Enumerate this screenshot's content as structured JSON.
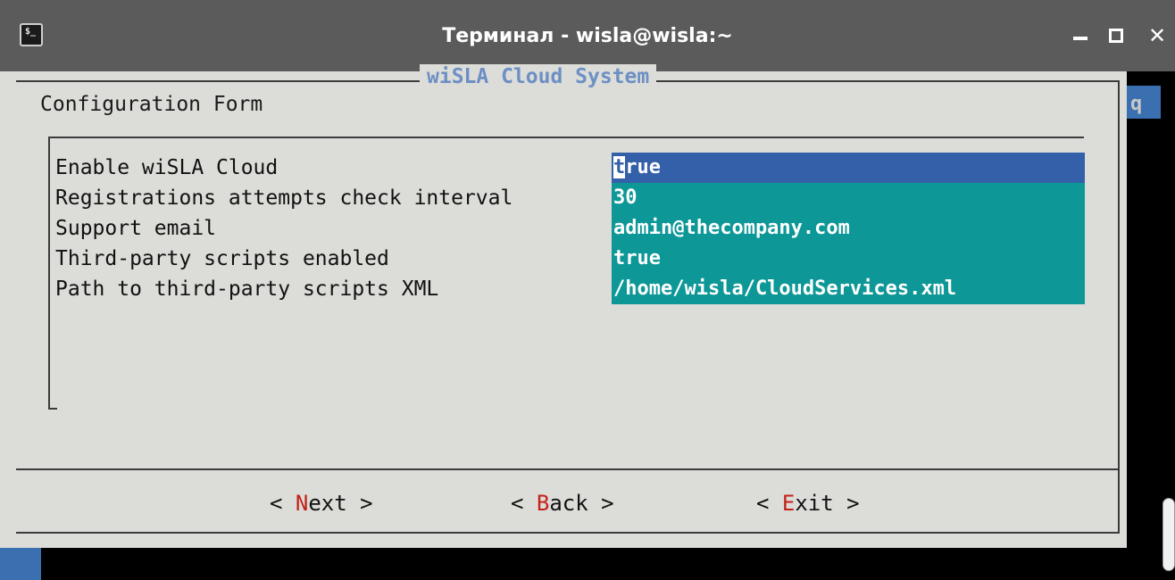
{
  "window": {
    "title": "Терминал - wisla@wisla:~",
    "app_icon": "terminal-icon",
    "app_icon_glyph": "$_",
    "close_glyph": "✕"
  },
  "terminal": {
    "behind_text": "q"
  },
  "dialog": {
    "title": "wiSLA Cloud System",
    "heading": "Configuration Form",
    "fields": [
      {
        "label": "Enable wiSLA Cloud",
        "value_first_char": "t",
        "value_rest": "rue",
        "selected": true
      },
      {
        "label": "Registrations attempts check interval",
        "value": "30"
      },
      {
        "label": "Support email",
        "value": "admin@thecompany.com"
      },
      {
        "label": "Third-party scripts enabled",
        "value": "true"
      },
      {
        "label": "Path to third-party scripts XML",
        "value": "/home/wisla/CloudServices.xml"
      }
    ],
    "buttons": {
      "next": {
        "prefix": "< ",
        "hot": "N",
        "rest": "ext >"
      },
      "back": {
        "prefix": "< ",
        "hot": "B",
        "rest": "ack >"
      },
      "exit": {
        "prefix": "< ",
        "hot": "E",
        "rest": "xit >"
      }
    }
  },
  "colors": {
    "dialog_bg": "#dcdcd8",
    "field_bg": "#0e9797",
    "selected_bg": "#3360a8",
    "hotkey": "#c4211a",
    "title_accent": "#6d8fc4"
  }
}
